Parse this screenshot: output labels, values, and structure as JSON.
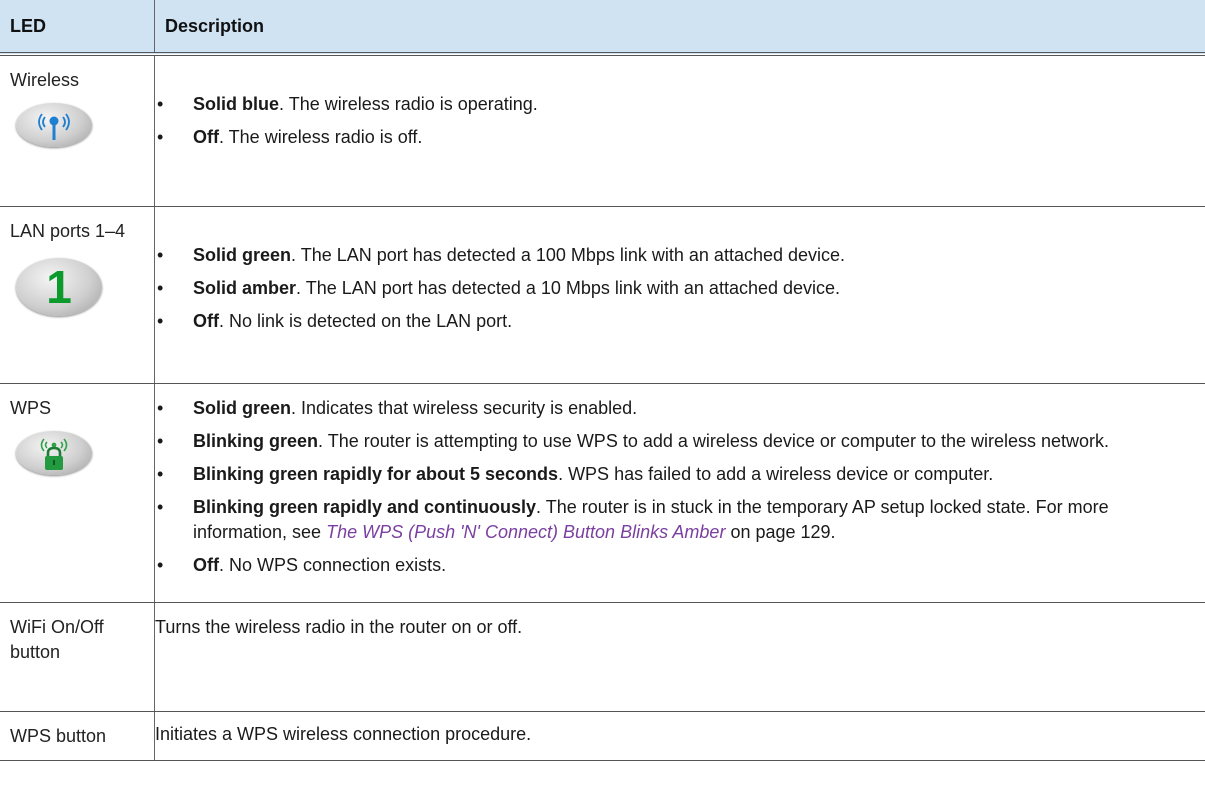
{
  "table": {
    "headers": {
      "led": "LED",
      "description": "Description"
    },
    "rows": [
      {
        "led": "Wireless",
        "icon": "wireless-led-icon",
        "items": [
          {
            "lead": "Solid blue",
            "text": ". The  wireless radio is operating."
          },
          {
            "lead": "Off",
            "text": ". The  wireless radio is off."
          }
        ]
      },
      {
        "led": "LAN ports 1–4",
        "icon": "lan-port-1-icon",
        "icon_text": "1",
        "items": [
          {
            "lead": "Solid green",
            "text": ".  The LAN port has detected a 100 Mbps link with an attached device."
          },
          {
            "lead": "Solid amber",
            "text": ".  The LAN port has detected a 10 Mbps link with an attached device."
          },
          {
            "lead": "Off",
            "text": ". No link is detected on the LAN port."
          }
        ]
      },
      {
        "led": "WPS",
        "icon": "wps-lock-icon",
        "items": [
          {
            "lead": "Solid green",
            "text": ". Indicates that wireless security is enabled."
          },
          {
            "lead": "Blinking green",
            "text": ". The router is attempting to use WPS to add a wireless device or computer to the wireless network."
          },
          {
            "lead": "Blinking green rapidly for about 5 seconds",
            "text": ". WPS has failed to add a wireless device or computer."
          },
          {
            "lead": "Blinking green rapidly and continuously",
            "text": ". The router is in stuck in the temporary  AP setup locked state. For more information, see ",
            "link": "The WPS (Push 'N' Connect) Button Blinks Amber",
            "tail": " on page 129."
          },
          {
            "lead": "Off",
            "text": ". No WPS connection exists."
          }
        ]
      },
      {
        "led": "WiFi On/Off button",
        "description": "Turns the wireless radio in the router on or off."
      },
      {
        "led": "WPS button",
        "description": "Initiates a WPS wireless connection procedure."
      }
    ]
  },
  "bullet_char": "•"
}
